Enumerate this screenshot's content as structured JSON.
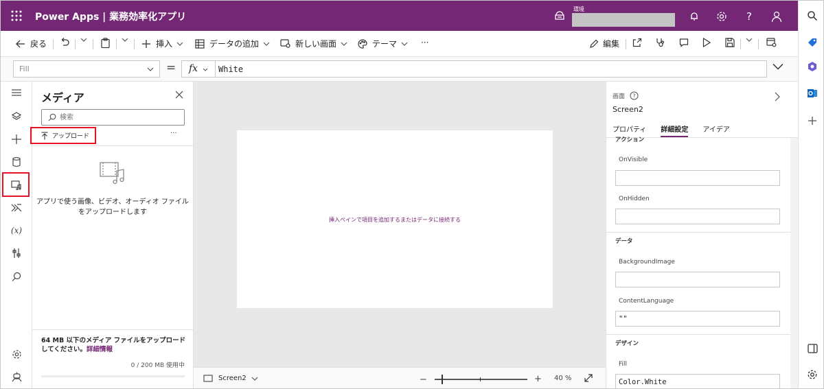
{
  "header": {
    "title": "Power Apps | 業務効率化アプリ",
    "env_label": "環境"
  },
  "toolbar": {
    "back": "戻る",
    "insert": "挿入",
    "add_data": "データの追加",
    "new_screen": "新しい画面",
    "theme": "テーマ",
    "more": "···",
    "edit": "編集"
  },
  "formula": {
    "property": "Fill",
    "equals": "=",
    "fx": "fx",
    "value": "White"
  },
  "media": {
    "title": "メディア",
    "search_placeholder": "検索",
    "upload": "アップロード",
    "more": "···",
    "empty_line1": "アプリで使う画像、ビデオ、オーディオ ファイル",
    "empty_line2": "をアップロードします",
    "footer_text": "64 MB 以下のメディア ファイルをアップロードしてください。",
    "footer_link": "詳細情報",
    "usage": "0 / 200 MB 使用中"
  },
  "canvas": {
    "hint": "挿入ペインで項目を追加するまたはデータに接続する"
  },
  "status": {
    "screen": "Screen2",
    "zoom": 40,
    "zoom_minus": "−",
    "zoom_plus": "+",
    "zoom_pct": "40 %"
  },
  "properties": {
    "type": "画面",
    "name": "Screen2",
    "tabs": [
      "プロパティ",
      "詳細設定",
      "アイデア"
    ],
    "active_tab": "詳細設定",
    "section_action": "アクション",
    "onvisible_label": "OnVisible",
    "onvisible_value": "",
    "onhidden_label": "OnHidden",
    "onhidden_value": "",
    "section_data": "データ",
    "bgimage_label": "BackgroundImage",
    "bgimage_value": "",
    "contentlang_label": "ContentLanguage",
    "contentlang_value": "\"\"",
    "section_design": "デザイン",
    "fill_label": "Fill",
    "fill_value": "Color.White"
  },
  "colors": {
    "brand": "#742774",
    "highlight": "#e81123"
  }
}
